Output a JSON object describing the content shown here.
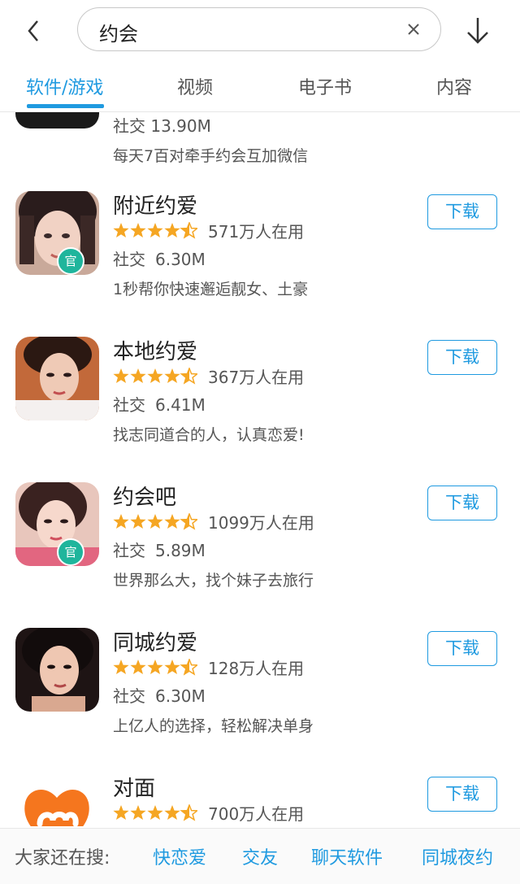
{
  "header": {
    "search_value": "约会"
  },
  "tabs": [
    {
      "label": "软件/游戏",
      "active": true
    },
    {
      "label": "视频",
      "active": false
    },
    {
      "label": "电子书",
      "active": false
    },
    {
      "label": "内容",
      "active": false
    }
  ],
  "partial_item": {
    "meta": "社交  13.90M",
    "desc": "每天7百对牵手约会互加微信"
  },
  "apps": [
    {
      "name": "附近约爱",
      "rating": 4.5,
      "users": "571万人在用",
      "category": "社交",
      "size": "6.30M",
      "desc": "1秒帮你快速邂逅靓女、土豪",
      "official": true,
      "button": "下载"
    },
    {
      "name": "本地约爱",
      "rating": 4.5,
      "users": "367万人在用",
      "category": "社交",
      "size": "6.41M",
      "desc": "找志同道合的人，认真恋爱!",
      "official": false,
      "button": "下载"
    },
    {
      "name": "约会吧",
      "rating": 4.5,
      "users": "1099万人在用",
      "category": "社交",
      "size": "5.89M",
      "desc": "世界那么大，找个妹子去旅行",
      "official": true,
      "button": "下载"
    },
    {
      "name": "同城约爱",
      "rating": 4.5,
      "users": "128万人在用",
      "category": "社交",
      "size": "6.30M",
      "desc": "上亿人的选择，轻松解决单身",
      "official": false,
      "button": "下载"
    },
    {
      "name": "对面",
      "rating": 4.5,
      "users": "700万人在用",
      "button": "下载"
    }
  ],
  "official_badge": "官",
  "bottom": {
    "label": "大家还在搜:",
    "keywords": [
      "快恋爱",
      "交友",
      "聊天软件",
      "同城夜约"
    ]
  },
  "colors": {
    "accent": "#1f9ae0",
    "star": "#f5a623",
    "badge": "#1fb59c"
  }
}
